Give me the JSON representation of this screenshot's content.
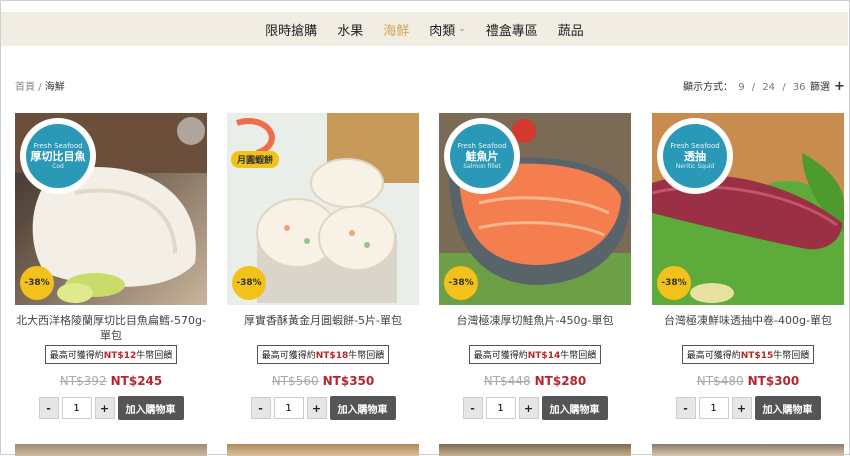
{
  "nav": {
    "items": [
      {
        "label": "限時搶購"
      },
      {
        "label": "水果"
      },
      {
        "label": "海鮮"
      },
      {
        "label": "肉類"
      },
      {
        "label": "禮盒專區"
      },
      {
        "label": "蔬品"
      }
    ],
    "active_color": "#d3a65a"
  },
  "breadcrumb": {
    "home": "首頁",
    "sep": "/",
    "current": "海鮮"
  },
  "display": {
    "label": "顯示方式：",
    "options": [
      "9",
      "24",
      "36"
    ],
    "seps": [
      "/",
      "/"
    ]
  },
  "filter": {
    "label": "篩選",
    "icon": "+"
  },
  "products": [
    {
      "badge_top": "Fresh Seafood",
      "badge_main": "厚切比目魚",
      "badge_sub": "Cod",
      "sale": "-38%",
      "title": "北大西洋格陵蘭厚切比目魚扁鱈-570g-單包",
      "points_prefix": "最高可獲得約",
      "points_num": "NT$12",
      "points_suffix": "牛幣回饋",
      "old_price": "NT$392",
      "new_price": "NT$245",
      "qty": "1",
      "minus": "-",
      "plus": "+",
      "add": "加入購物車"
    },
    {
      "badge_main": "月圓蝦餅",
      "sale": "-38%",
      "title": "厚實香酥黃金月圓蝦餅-5片-單包",
      "points_prefix": "最高可獲得約",
      "points_num": "NT$18",
      "points_suffix": "牛幣回饋",
      "old_price": "NT$560",
      "new_price": "NT$350",
      "qty": "1",
      "minus": "-",
      "plus": "+",
      "add": "加入購物車"
    },
    {
      "badge_top": "Fresh Seafood",
      "badge_main": "鮭魚片",
      "badge_sub": "Salmon fillet",
      "sale": "-38%",
      "title": "台灣極凍厚切鮭魚片-450g-單包",
      "points_prefix": "最高可獲得約",
      "points_num": "NT$14",
      "points_suffix": "牛幣回饋",
      "old_price": "NT$448",
      "new_price": "NT$280",
      "qty": "1",
      "minus": "-",
      "plus": "+",
      "add": "加入購物車"
    },
    {
      "badge_top": "Fresh Seafood",
      "badge_main": "透抽",
      "badge_sub": "Neritic Squid",
      "sale": "-38%",
      "title": "台灣極凍鮮味透抽中卷-400g-單包",
      "points_prefix": "最高可獲得約",
      "points_num": "NT$15",
      "points_suffix": "牛幣回饋",
      "old_price": "NT$480",
      "new_price": "NT$300",
      "qty": "1",
      "minus": "-",
      "plus": "+",
      "add": "加入購物車"
    }
  ],
  "colors": {
    "nav_bg": "#f1ede3",
    "badge": "#2a98b7",
    "sale": "#f2c21b",
    "price": "#b5272d",
    "button": "#555555"
  }
}
